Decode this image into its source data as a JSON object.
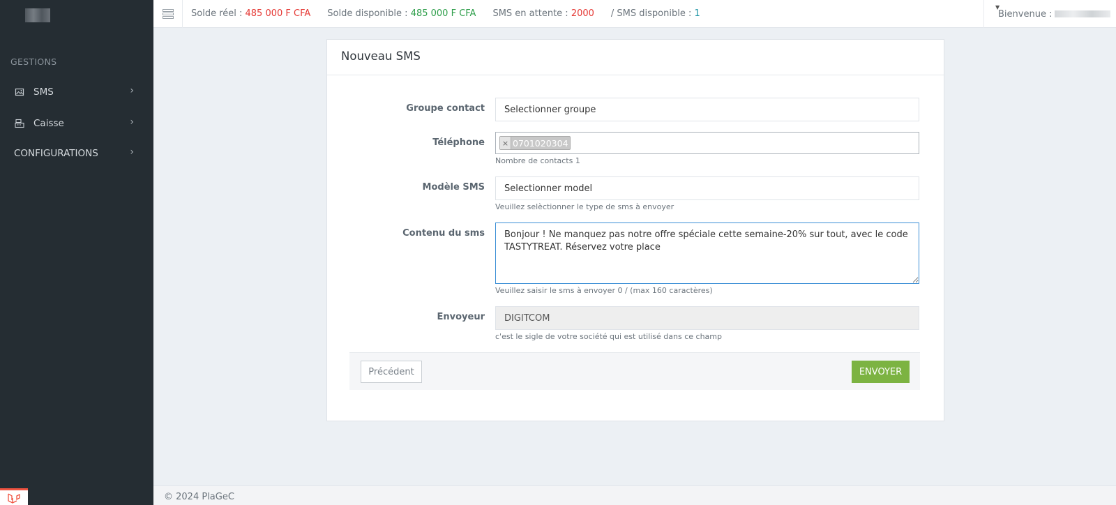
{
  "sidebar": {
    "section_title": "GESTIONS",
    "items": [
      {
        "label": "SMS",
        "icon": "image-icon"
      },
      {
        "label": "Caisse",
        "icon": "cash-register-icon"
      },
      {
        "label": "CONFIGURATIONS"
      }
    ]
  },
  "topbar": {
    "solde_reel_label": "Solde réel : ",
    "solde_reel_value": "485 000 F CFA",
    "solde_dispo_label": "Solde disponible : ",
    "solde_dispo_value": "485 000 F CFA",
    "sms_attente_label": "SMS en attente : ",
    "sms_attente_value": "2000",
    "sms_dispo_label": "/ SMS disponible : ",
    "sms_dispo_value": "1",
    "welcome_label": "Bienvenue : "
  },
  "form": {
    "title": "Nouveau SMS",
    "groupe_label": "Groupe contact",
    "groupe_value": "Selectionner groupe",
    "telephone_label": "Téléphone",
    "telephone_tag": "0701020304",
    "telephone_help": "Nombre de contacts 1",
    "modele_label": "Modèle SMS",
    "modele_value": "Selectionner model",
    "modele_help": "Veuillez selèctionner le type de sms à envoyer",
    "contenu_label": "Contenu du sms",
    "contenu_value": "Bonjour ! Ne manquez pas notre offre spéciale cette semaine-20% sur tout, avec le code TASTYTREAT. Réservez votre place",
    "contenu_help": "Veuillez saisir le sms à envoyer 0 / (max 160 caractères)",
    "envoyeur_label": "Envoyeur",
    "envoyeur_value": "DIGITCOM",
    "envoyeur_help": "c'est le sigle de votre société qui est utilisé dans ce champ",
    "prev_button": "Précédent",
    "send_button": "ENVOYER"
  },
  "footer": {
    "text": "© 2024 PlaGeC"
  },
  "colors": {
    "sidebar_bg": "#252d33",
    "accent_green": "#7cb342",
    "value_red": "#e53935",
    "value_green": "#2e9e4a",
    "value_teal": "#2196a6",
    "focus_blue": "#3b8fd6"
  }
}
